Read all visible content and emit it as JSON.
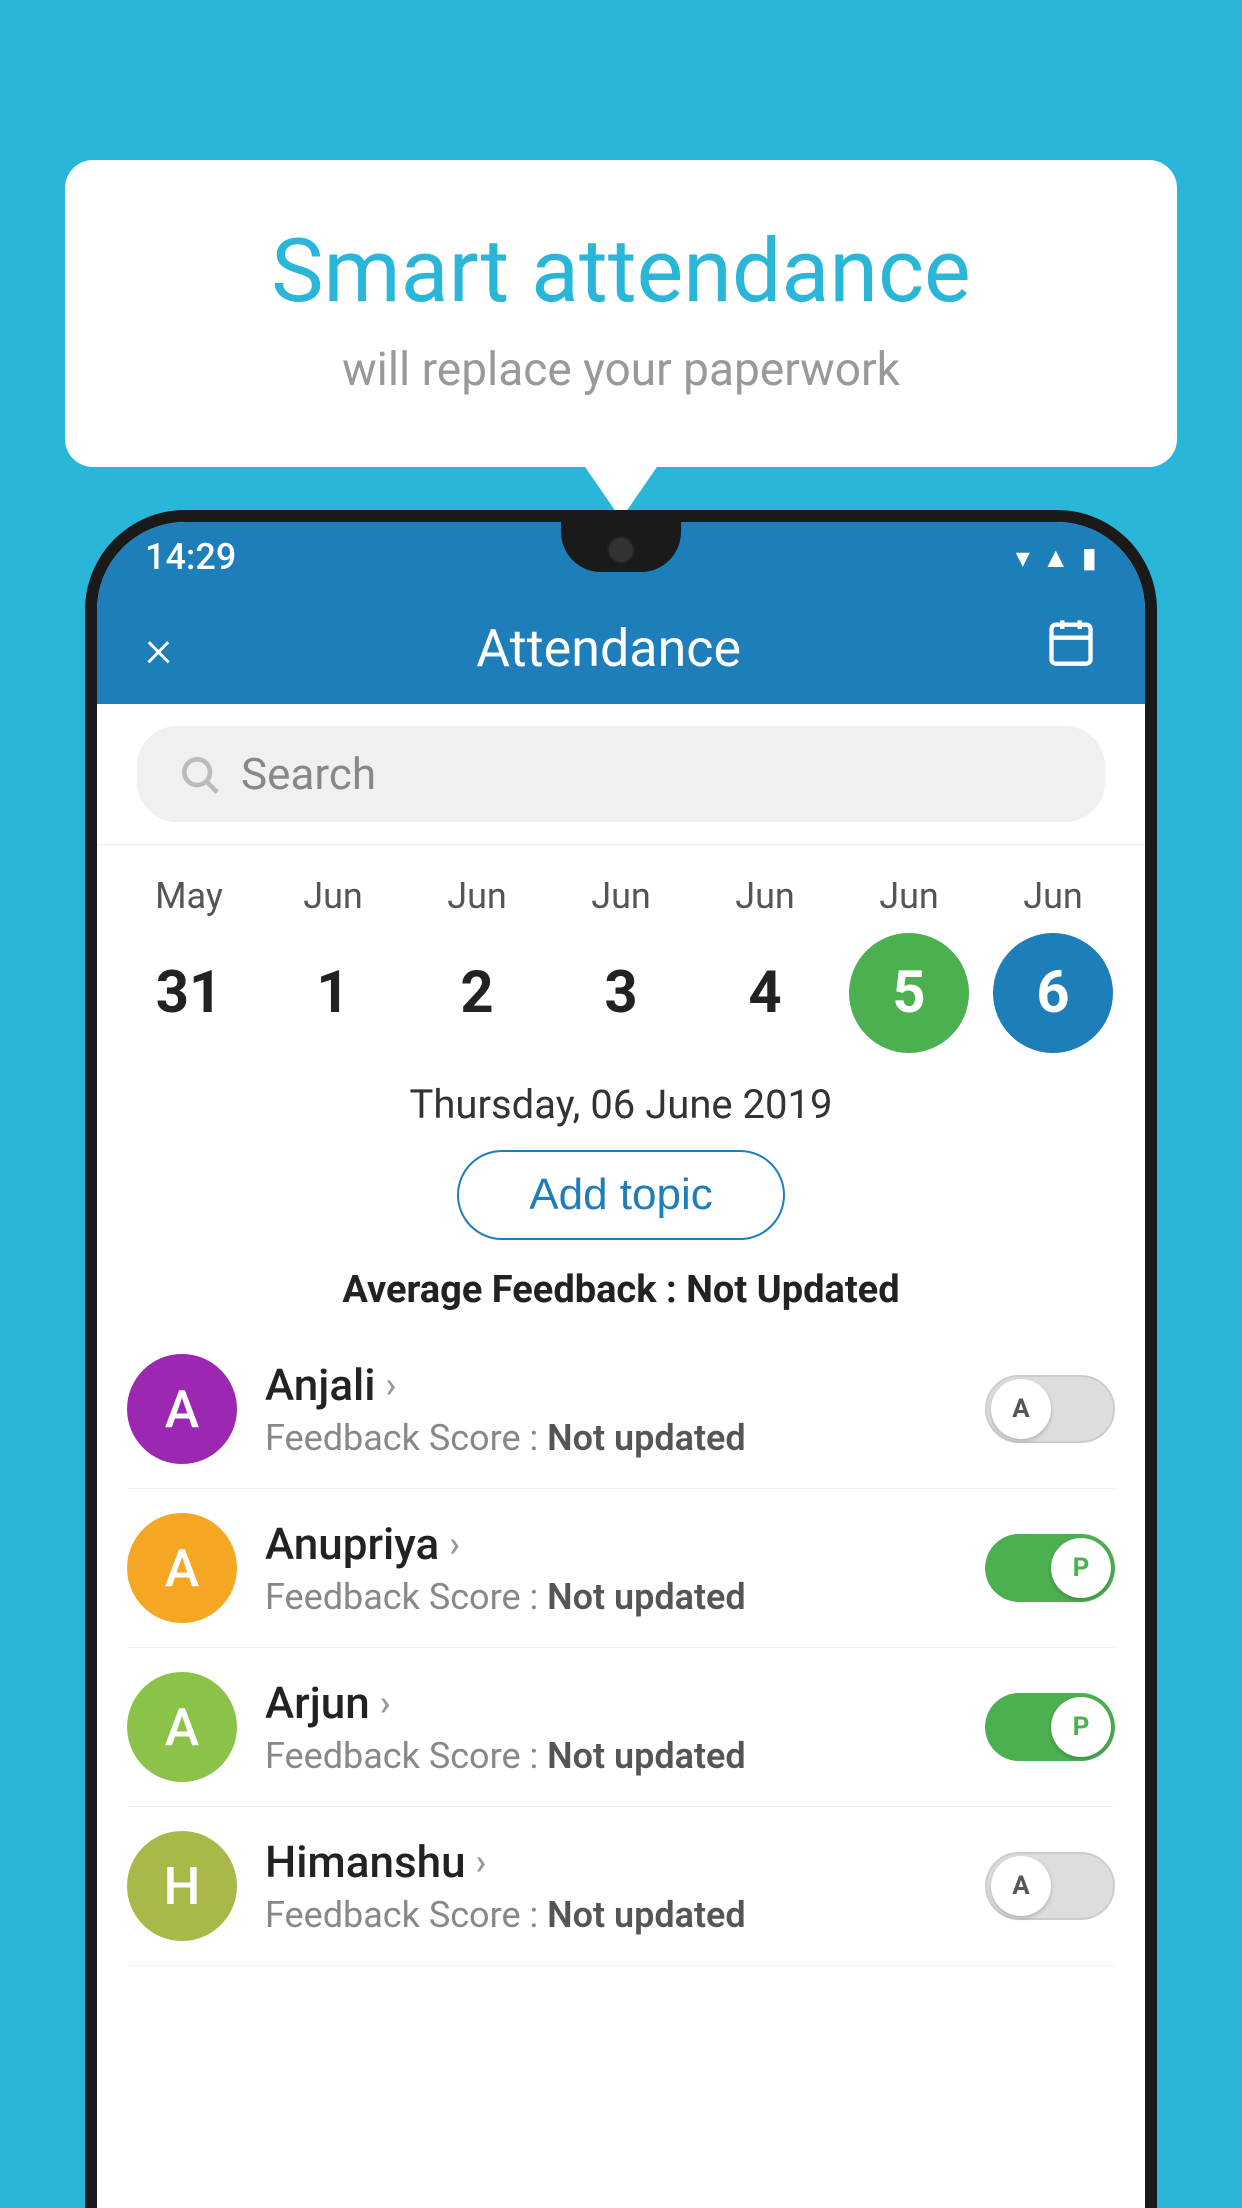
{
  "background_color": "#29b6d8",
  "bubble": {
    "title": "Smart attendance",
    "subtitle": "will replace your paperwork"
  },
  "status_bar": {
    "time": "14:29",
    "icons": [
      "wifi",
      "signal",
      "battery"
    ]
  },
  "header": {
    "title": "Attendance",
    "close_label": "×",
    "calendar_label": "📅"
  },
  "search": {
    "placeholder": "Search"
  },
  "calendar": {
    "days": [
      {
        "month": "May",
        "date": "31",
        "style": "normal"
      },
      {
        "month": "Jun",
        "date": "1",
        "style": "normal"
      },
      {
        "month": "Jun",
        "date": "2",
        "style": "normal"
      },
      {
        "month": "Jun",
        "date": "3",
        "style": "normal"
      },
      {
        "month": "Jun",
        "date": "4",
        "style": "normal"
      },
      {
        "month": "Jun",
        "date": "5",
        "style": "today"
      },
      {
        "month": "Jun",
        "date": "6",
        "style": "selected"
      }
    ]
  },
  "selected_date": "Thursday, 06 June 2019",
  "add_topic_label": "Add topic",
  "avg_feedback_label": "Average Feedback :",
  "avg_feedback_value": "Not Updated",
  "students": [
    {
      "name": "Anjali",
      "initial": "A",
      "avatar_color": "#9c27b0",
      "score_label": "Feedback Score :",
      "score_value": "Not updated",
      "toggle_state": "off",
      "toggle_letter": "A"
    },
    {
      "name": "Anupriya",
      "initial": "A",
      "avatar_color": "#f5a623",
      "score_label": "Feedback Score :",
      "score_value": "Not updated",
      "toggle_state": "on",
      "toggle_letter": "P"
    },
    {
      "name": "Arjun",
      "initial": "A",
      "avatar_color": "#8bc34a",
      "score_label": "Feedback Score :",
      "score_value": "Not updated",
      "toggle_state": "on",
      "toggle_letter": "P"
    },
    {
      "name": "Himanshu",
      "initial": "H",
      "avatar_color": "#aab84a",
      "score_label": "Feedback Score :",
      "score_value": "Not updated",
      "toggle_state": "off",
      "toggle_letter": "A"
    }
  ]
}
